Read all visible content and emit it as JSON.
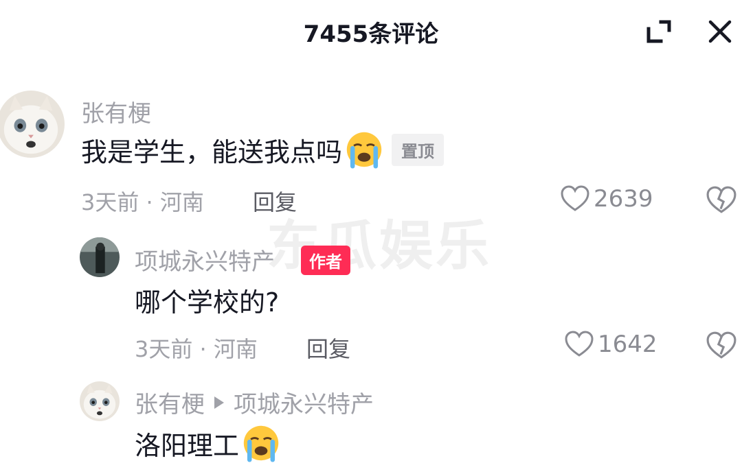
{
  "header": {
    "title": "7455条评论"
  },
  "watermark": "东瓜娱乐",
  "comments": [
    {
      "username": "张有梗",
      "text": "我是学生，能送我点吗",
      "badge": "置顶",
      "time": "3天前 · 河南",
      "reply_label": "回复",
      "likes": "2639"
    },
    {
      "username": "项城永兴特产",
      "author_badge": "作者",
      "text": "哪个学校的?",
      "time": "3天前 · 河南",
      "reply_label": "回复",
      "likes": "1642"
    },
    {
      "username": "张有梗",
      "reply_to": "项城永兴特产",
      "text": "洛阳理工"
    }
  ],
  "icons": {
    "expand": "expand-icon",
    "close": "close-icon",
    "like": "heart-icon",
    "dislike": "broken-heart-icon",
    "emoji": "crying-face-emoji"
  },
  "colors": {
    "author_badge": "#fe2c55",
    "muted_text": "#a0a1a8",
    "main_text": "#161823"
  }
}
